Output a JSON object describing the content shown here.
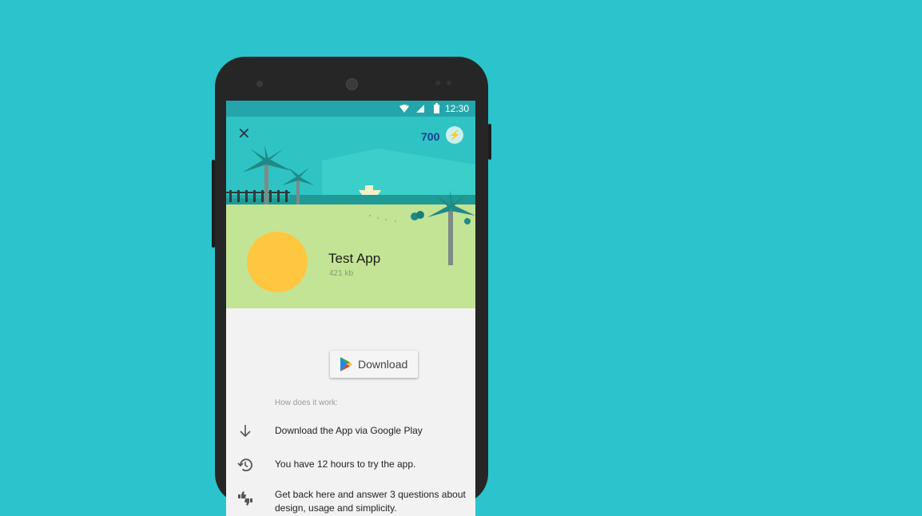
{
  "status_bar": {
    "time": "12:30"
  },
  "header": {
    "points": "700"
  },
  "app": {
    "name": "Test App",
    "size": "421 kb"
  },
  "download_button": {
    "label": "Download"
  },
  "how_it_works": {
    "title": "How does it work:",
    "steps": [
      {
        "icon": "arrow-down-icon",
        "text": "Download the App via Google Play"
      },
      {
        "icon": "history-icon",
        "text": "You have 12 hours to try the app."
      },
      {
        "icon": "thumbs-up-down-icon",
        "text": "Get back here and answer 3 questions about design, usage and simplicity."
      }
    ]
  },
  "colors": {
    "background": "#2bc4cd",
    "status_bar": "#24a5ab",
    "grass": "#c3e494",
    "app_icon": "#ffc640",
    "points": "#1e3d8f"
  }
}
